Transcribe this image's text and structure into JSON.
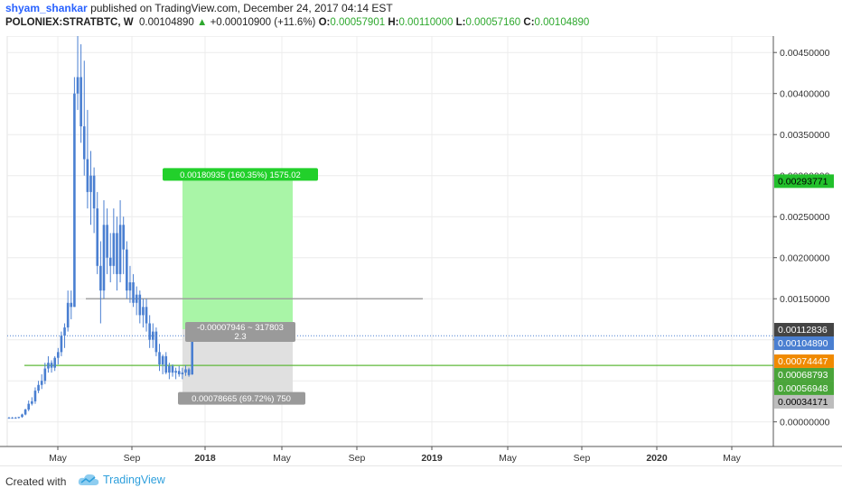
{
  "header": {
    "author": "shyam_shankar",
    "published_text": "published on TradingView.com, December 24, 2017 04:14 EST",
    "symbol": "POLONIEX:STRATBTC, W",
    "last": "0.00104890",
    "change_arrow": "▲",
    "change": "+0.00010900 (+11.6%)",
    "o_label": "O:",
    "o": "0.00057901",
    "h_label": "H:",
    "h": "0.00110000",
    "l_label": "L:",
    "l": "0.00057160",
    "c_label": "C:",
    "c": "0.00104890"
  },
  "footer": {
    "created_with": "Created with",
    "brand": "TradingView"
  },
  "colors": {
    "candle": "#4a7fd1",
    "target_zone": "#a9f5a7",
    "stop_zone": "#e0e0e0",
    "support_line": "#5fb83a",
    "resistance_line": "#9a9a9a",
    "last_price_line": "#4a7fd1"
  },
  "chart_data": {
    "type": "candlestick",
    "x_tick_labels": [
      "May",
      "Sep",
      "2018",
      "May",
      "Sep",
      "2019",
      "May",
      "Sep",
      "2020",
      "May"
    ],
    "y_tick_labels": [
      "0.00450000",
      "0.00400000",
      "0.00350000",
      "0.00300000",
      "0.00250000",
      "0.00200000",
      "0.00150000",
      "0.00100000",
      "0.00050000",
      "0.00000000"
    ],
    "ylim": [
      -0.0003,
      0.0047
    ],
    "price_labels": [
      {
        "text": "0.00293771",
        "value": 0.00293771,
        "bg": "#22c02b",
        "fg": "#000000"
      },
      {
        "text": "0.00112836",
        "value": 0.00112836,
        "bg": "#444444",
        "fg": "#ffffff"
      },
      {
        "text": "0.00104890",
        "value": 0.0010489,
        "bg": "#4a7fd1",
        "fg": "#ffffff"
      },
      {
        "text": "0.00074447",
        "value": 0.00074447,
        "bg": "#f08a00",
        "fg": "#ffffff"
      },
      {
        "text": "0.00068793",
        "value": 0.00068793,
        "bg": "#4aa53a",
        "fg": "#ffffff"
      },
      {
        "text": "0.00056948",
        "value": 0.00056948,
        "bg": "#4aa53a",
        "fg": "#ffffff"
      },
      {
        "text": "0.00034171",
        "value": 0.00034171,
        "bg": "#bdbdbd",
        "fg": "#000000"
      }
    ],
    "position_tool": {
      "entry": 0.00112836,
      "target": 0.00293771,
      "stop": 0.00034171,
      "profit_label": "0.00180935 (160.35%) 1575.02",
      "loss_label": "0.00078665 (69.72%) 750",
      "info_label_1": "-0.00007946 ~ 317803",
      "info_label_2": "2.3"
    },
    "horizontal_lines": [
      {
        "name": "support",
        "value": 0.00068793
      },
      {
        "name": "resistance",
        "value": 0.0015
      }
    ],
    "candles": [
      [
        5e-05,
        6e-05,
        4e-05,
        5e-05
      ],
      [
        5e-05,
        6e-05,
        4e-05,
        5e-05
      ],
      [
        5e-05,
        6e-05,
        4e-05,
        5e-05
      ],
      [
        5e-05,
        6e-05,
        4e-05,
        6e-05
      ],
      [
        6e-05,
        0.0001,
        5e-05,
        9e-05
      ],
      [
        9e-05,
        0.00016,
        8e-05,
        0.00015
      ],
      [
        0.00015,
        0.00026,
        0.00013,
        0.00022
      ],
      [
        0.00022,
        0.0003,
        0.0002,
        0.00025
      ],
      [
        0.00025,
        0.00042,
        0.00022,
        0.00038
      ],
      [
        0.00038,
        0.0005,
        0.00035,
        0.00045
      ],
      [
        0.00045,
        0.00058,
        0.0004,
        0.0005
      ],
      [
        0.0005,
        0.00072,
        0.00046,
        0.00065
      ],
      [
        0.00065,
        0.0008,
        0.0006,
        0.00072
      ],
      [
        0.00072,
        0.00075,
        0.0006,
        0.00066
      ],
      [
        0.00066,
        0.0008,
        0.00062,
        0.00078
      ],
      [
        0.00078,
        0.0009,
        0.0007,
        0.00085
      ],
      [
        0.00085,
        0.0011,
        0.0008,
        0.00105
      ],
      [
        0.00105,
        0.0012,
        0.0009,
        0.00115
      ],
      [
        0.00115,
        0.0016,
        0.0011,
        0.00145
      ],
      [
        0.00145,
        0.0016,
        0.00125,
        0.0014
      ],
      [
        0.0014,
        0.0042,
        0.0014,
        0.004
      ],
      [
        0.004,
        0.0047,
        0.0038,
        0.0042
      ],
      [
        0.0042,
        0.0046,
        0.0034,
        0.0036
      ],
      [
        0.0036,
        0.0044,
        0.003,
        0.0032
      ],
      [
        0.0032,
        0.0038,
        0.0026,
        0.0028
      ],
      [
        0.0028,
        0.0033,
        0.0024,
        0.003
      ],
      [
        0.003,
        0.0031,
        0.0023,
        0.0026
      ],
      [
        0.0026,
        0.0028,
        0.0018,
        0.0019
      ],
      [
        0.0019,
        0.0022,
        0.0012,
        0.0016
      ],
      [
        0.0016,
        0.0027,
        0.0015,
        0.0024
      ],
      [
        0.0024,
        0.0026,
        0.0018,
        0.002
      ],
      [
        0.002,
        0.0023,
        0.0017,
        0.0019
      ],
      [
        0.0019,
        0.0026,
        0.0018,
        0.0023
      ],
      [
        0.0023,
        0.0025,
        0.0016,
        0.0018
      ],
      [
        0.0018,
        0.0027,
        0.0017,
        0.0024
      ],
      [
        0.0024,
        0.0025,
        0.0018,
        0.0021
      ],
      [
        0.0021,
        0.0022,
        0.0015,
        0.0016
      ],
      [
        0.0016,
        0.0019,
        0.00145,
        0.0017
      ],
      [
        0.0017,
        0.0018,
        0.0014,
        0.00145
      ],
      [
        0.00145,
        0.00165,
        0.0013,
        0.00155
      ],
      [
        0.00155,
        0.0016,
        0.0012,
        0.0013
      ],
      [
        0.0013,
        0.0015,
        0.00115,
        0.0014
      ],
      [
        0.0014,
        0.0015,
        0.0011,
        0.0012
      ],
      [
        0.0012,
        0.0013,
        0.0009,
        0.001
      ],
      [
        0.001,
        0.0012,
        0.0009,
        0.0011
      ],
      [
        0.0011,
        0.00115,
        0.0008,
        0.00085
      ],
      [
        0.00085,
        0.00095,
        0.00062,
        0.0007
      ],
      [
        0.0007,
        0.00082,
        0.00058,
        0.0008
      ],
      [
        0.0008,
        0.00085,
        0.00058,
        0.0006
      ],
      [
        0.0006,
        0.00072,
        0.00052,
        0.00068
      ],
      [
        0.00068,
        0.0007,
        0.00055,
        0.0006
      ],
      [
        0.0006,
        0.00066,
        0.00052,
        0.00062
      ],
      [
        0.00062,
        0.00068,
        0.00055,
        0.00058
      ],
      [
        0.00058,
        0.00066,
        0.00052,
        0.0006
      ],
      [
        0.0006,
        0.00069,
        0.00056,
        0.00064
      ],
      [
        0.00064,
        0.00066,
        0.00055,
        0.00057
      ],
      [
        0.00057901,
        0.0011,
        0.0005716,
        0.0010489
      ]
    ]
  }
}
